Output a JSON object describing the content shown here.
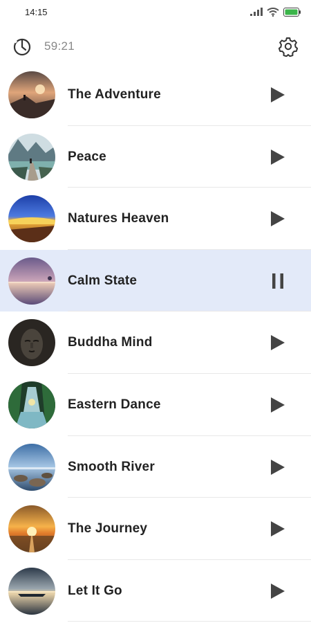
{
  "status_bar": {
    "time": "14:15",
    "battery_color": "#3bb54a"
  },
  "header": {
    "timer": "59:21"
  },
  "colors": {
    "active_row": "#e3eaf9",
    "icon": "#444444"
  },
  "tracks": [
    {
      "title": "The Adventure",
      "control": "play-icon",
      "active": false
    },
    {
      "title": "Peace",
      "control": "play-icon",
      "active": false
    },
    {
      "title": "Natures Heaven",
      "control": "play-icon",
      "active": false
    },
    {
      "title": "Calm State",
      "control": "pause-icon",
      "active": true
    },
    {
      "title": "Buddha Mind",
      "control": "play-icon",
      "active": false
    },
    {
      "title": "Eastern Dance",
      "control": "play-icon",
      "active": false
    },
    {
      "title": "Smooth River",
      "control": "play-icon",
      "active": false
    },
    {
      "title": "The Journey",
      "control": "play-icon",
      "active": false
    },
    {
      "title": "Let It Go",
      "control": "play-icon",
      "active": false
    }
  ]
}
